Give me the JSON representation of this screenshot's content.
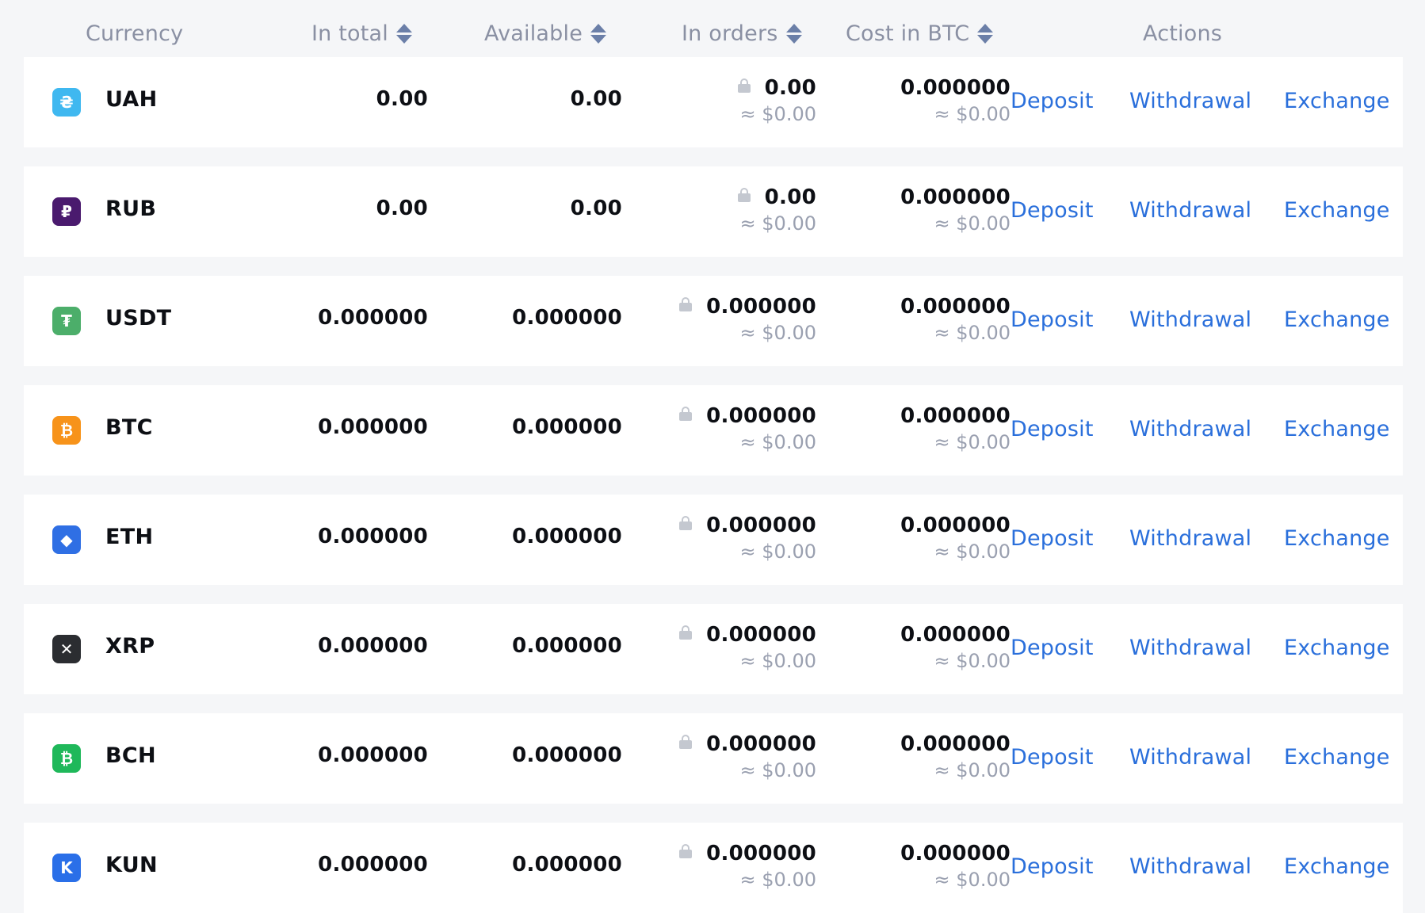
{
  "header": {
    "currency": "Currency",
    "in_total": "In total",
    "available": "Available",
    "in_orders": "In orders",
    "cost_btc": "Cost in BTC",
    "actions": "Actions"
  },
  "actions": {
    "deposit": "Deposit",
    "withdrawal": "Withdrawal",
    "exchange": "Exchange"
  },
  "colors": {
    "accent": "#2a6fdb",
    "muted": "#8a90a3"
  },
  "rows": [
    {
      "icon": "hryvnia-icon",
      "glyph": "₴",
      "color": "#3fb8f0",
      "name": "UAH",
      "total": "0.00",
      "available": "0.00",
      "orders": "0.00",
      "orders_usd": "≈ $0.00",
      "btc": "0.000000",
      "btc_usd": "≈ $0.00"
    },
    {
      "icon": "ruble-icon",
      "glyph": "₽",
      "color": "#4a1a6e",
      "name": "RUB",
      "total": "0.00",
      "available": "0.00",
      "orders": "0.00",
      "orders_usd": "≈ $0.00",
      "btc": "0.000000",
      "btc_usd": "≈ $0.00"
    },
    {
      "icon": "tether-icon",
      "glyph": "₮",
      "color": "#4cae6a",
      "name": "USDT",
      "total": "0.000000",
      "available": "0.000000",
      "orders": "0.000000",
      "orders_usd": "≈ $0.00",
      "btc": "0.000000",
      "btc_usd": "≈ $0.00"
    },
    {
      "icon": "bitcoin-icon",
      "glyph": "₿",
      "color": "#f7931a",
      "name": "BTC",
      "total": "0.000000",
      "available": "0.000000",
      "orders": "0.000000",
      "orders_usd": "≈ $0.00",
      "btc": "0.000000",
      "btc_usd": "≈ $0.00"
    },
    {
      "icon": "ethereum-icon",
      "glyph": "◆",
      "color": "#2f6fe4",
      "name": "ETH",
      "total": "0.000000",
      "available": "0.000000",
      "orders": "0.000000",
      "orders_usd": "≈ $0.00",
      "btc": "0.000000",
      "btc_usd": "≈ $0.00"
    },
    {
      "icon": "ripple-icon",
      "glyph": "✕",
      "color": "#2b2d31",
      "name": "XRP",
      "total": "0.000000",
      "available": "0.000000",
      "orders": "0.000000",
      "orders_usd": "≈ $0.00",
      "btc": "0.000000",
      "btc_usd": "≈ $0.00"
    },
    {
      "icon": "bitcoin-cash-icon",
      "glyph": "₿",
      "color": "#1fb85a",
      "name": "BCH",
      "total": "0.000000",
      "available": "0.000000",
      "orders": "0.000000",
      "orders_usd": "≈ $0.00",
      "btc": "0.000000",
      "btc_usd": "≈ $0.00"
    },
    {
      "icon": "kun-icon",
      "glyph": "K",
      "color": "#2a6fe8",
      "name": "KUN",
      "total": "0.000000",
      "available": "0.000000",
      "orders": "0.000000",
      "orders_usd": "≈ $0.00",
      "btc": "0.000000",
      "btc_usd": "≈ $0.00"
    }
  ]
}
